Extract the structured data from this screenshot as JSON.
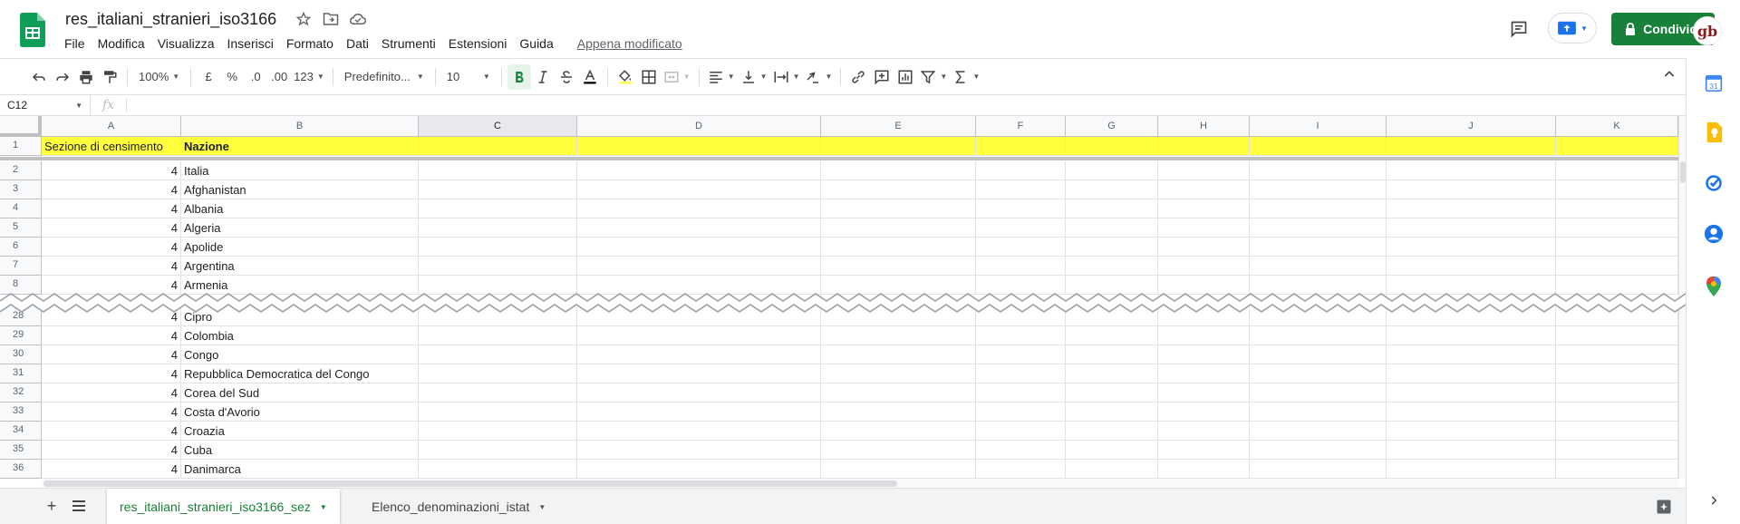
{
  "header": {
    "title": "res_italiani_stranieri_iso3166",
    "menu": [
      "File",
      "Modifica",
      "Visualizza",
      "Inserisci",
      "Formato",
      "Dati",
      "Strumenti",
      "Estensioni",
      "Guida"
    ],
    "last_edit": "Appena modificato",
    "share_label": "Condividi",
    "avatar_text": "gb",
    "share_color": "#188038"
  },
  "toolbar": {
    "zoom": "100%",
    "currency": "£",
    "percent": "%",
    "decrease_decimals": ".0",
    "increase_decimals": ".00",
    "more_formats": "123",
    "font": "Predefinito...",
    "font_size": "10"
  },
  "formula_bar": {
    "cell_ref": "C12",
    "fx": "fx",
    "value": ""
  },
  "grid": {
    "columns": [
      "A",
      "B",
      "C",
      "D",
      "E",
      "F",
      "G",
      "H",
      "I",
      "J",
      "K"
    ],
    "selected_column": "C",
    "header_row": {
      "number": "1",
      "a": "Sezione di censimento",
      "b": "Nazione"
    },
    "header_fill": "#ffff3c",
    "rows_top": [
      {
        "number": "2",
        "a": "4",
        "b": "Italia"
      },
      {
        "number": "3",
        "a": "4",
        "b": "Afghanistan"
      },
      {
        "number": "4",
        "a": "4",
        "b": "Albania"
      },
      {
        "number": "5",
        "a": "4",
        "b": "Algeria"
      },
      {
        "number": "6",
        "a": "4",
        "b": "Apolide"
      },
      {
        "number": "7",
        "a": "4",
        "b": "Argentina"
      },
      {
        "number": "8",
        "a": "4",
        "b": "Armenia"
      }
    ],
    "rows_bottom": [
      {
        "number": "28",
        "a": "4",
        "b": "Cipro"
      },
      {
        "number": "29",
        "a": "4",
        "b": "Colombia"
      },
      {
        "number": "30",
        "a": "4",
        "b": "Congo"
      },
      {
        "number": "31",
        "a": "4",
        "b": "Repubblica Democratica del Congo"
      },
      {
        "number": "32",
        "a": "4",
        "b": "Corea del Sud"
      },
      {
        "number": "33",
        "a": "4",
        "b": "Costa d'Avorio"
      },
      {
        "number": "34",
        "a": "4",
        "b": "Croazia"
      },
      {
        "number": "35",
        "a": "4",
        "b": "Cuba"
      },
      {
        "number": "36",
        "a": "4",
        "b": "Danimarca"
      }
    ]
  },
  "sheets": [
    {
      "label": "res_italiani_stranieri_iso3166_sez",
      "active": true
    },
    {
      "label": "Elenco_denominazioni_istat",
      "active": false
    }
  ],
  "side_panel": [
    "calendar-icon",
    "keep-icon",
    "tasks-icon",
    "contacts-icon",
    "maps-icon"
  ]
}
